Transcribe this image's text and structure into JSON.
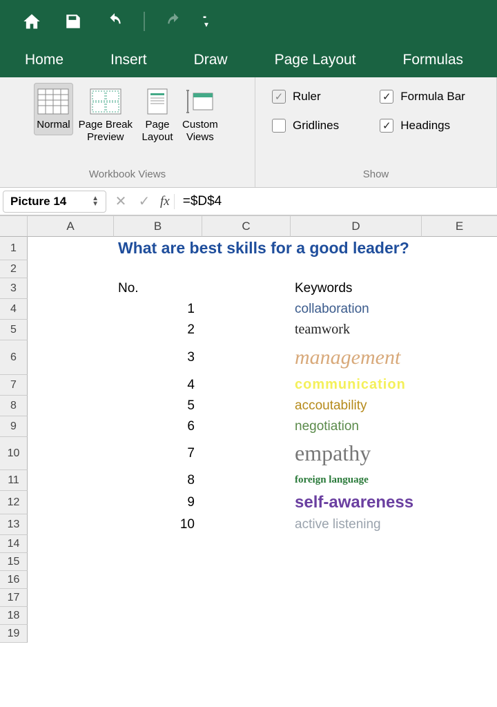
{
  "qat": {
    "home": "Home",
    "save": "Save",
    "undo": "Undo",
    "redo": "Redo"
  },
  "tabs": [
    "Home",
    "Insert",
    "Draw",
    "Page Layout",
    "Formulas"
  ],
  "ribbon": {
    "views": {
      "normal": "Normal",
      "page_break": "Page Break\nPreview",
      "page_layout": "Page\nLayout",
      "custom_views": "Custom\nViews",
      "group_label": "Workbook Views"
    },
    "show": {
      "ruler": "Ruler",
      "formula_bar": "Formula Bar",
      "gridlines": "Gridlines",
      "headings": "Headings",
      "group_label": "Show"
    }
  },
  "name_box": "Picture 14",
  "fx_label": "fx",
  "formula": "=$D$4",
  "columns": [
    "A",
    "B",
    "C",
    "D",
    "E"
  ],
  "rows": [
    "1",
    "2",
    "3",
    "4",
    "5",
    "6",
    "7",
    "8",
    "9",
    "10",
    "11",
    "12",
    "13",
    "14",
    "15",
    "16",
    "17",
    "18",
    "19"
  ],
  "sheet": {
    "title": "What are best skills for a good leader?",
    "header_no": "No.",
    "header_kw": "Keywords",
    "items": [
      {
        "n": "1",
        "kw": "collaboration",
        "cls": "kw1"
      },
      {
        "n": "2",
        "kw": "teamwork",
        "cls": "kw2"
      },
      {
        "n": "3",
        "kw": "management",
        "cls": "kw3"
      },
      {
        "n": "4",
        "kw": "communication",
        "cls": "kw4"
      },
      {
        "n": "5",
        "kw": "accoutability",
        "cls": "kw5"
      },
      {
        "n": "6",
        "kw": "negotiation",
        "cls": "kw6"
      },
      {
        "n": "7",
        "kw": "empathy",
        "cls": "kw7"
      },
      {
        "n": "8",
        "kw": "foreign language",
        "cls": "kw8"
      },
      {
        "n": "9",
        "kw": "self-awareness",
        "cls": "kw9"
      },
      {
        "n": "10",
        "kw": "active listening",
        "cls": "kw10"
      }
    ]
  },
  "row_heights": {
    "1": 34,
    "2": 26,
    "3": 30,
    "4": 30,
    "5": 30,
    "6": 50,
    "7": 30,
    "8": 30,
    "9": 30,
    "10": 48,
    "11": 30,
    "12": 34,
    "13": 30,
    "14": 26,
    "15": 26,
    "16": 26,
    "17": 26,
    "18": 26,
    "19": 26
  }
}
